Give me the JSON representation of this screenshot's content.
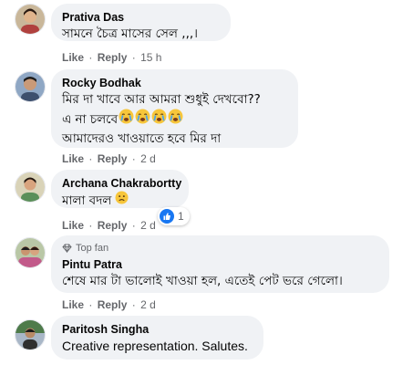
{
  "actions": {
    "like": "Like",
    "reply": "Reply",
    "sep": "·"
  },
  "comments": [
    {
      "author": "Prativa Das",
      "lines": [
        "সামনে চৈত্র মাসের সেল ,,,।"
      ],
      "time": "15 h"
    },
    {
      "author": "Rocky Bodhak",
      "lines": [
        "মির দা খাবে আর আমরা শুধুই দেখবো??",
        "এ না চলবে",
        "আমাদেরও খাওয়াতে হবে মির দা"
      ],
      "time": "2 d",
      "emoji_count": 4
    },
    {
      "author": "Archana Chakrabortty",
      "lines": [
        "মালা বদল"
      ],
      "time": "2 d",
      "reaction_count": "1"
    },
    {
      "author": "Pintu Patra",
      "badge": "Top fan",
      "lines": [
        "শেষে মার টা ভালোই খাওয়া হল, এতেই পেট ভরে গেলো।"
      ],
      "time": "2 d"
    },
    {
      "author": "Paritosh Singha",
      "lines": [
        "Creative representation. Salutes."
      ]
    }
  ],
  "colors": {
    "bubble": "#f0f2f5",
    "meta": "#65676b",
    "like_blue": "#1877f2"
  }
}
